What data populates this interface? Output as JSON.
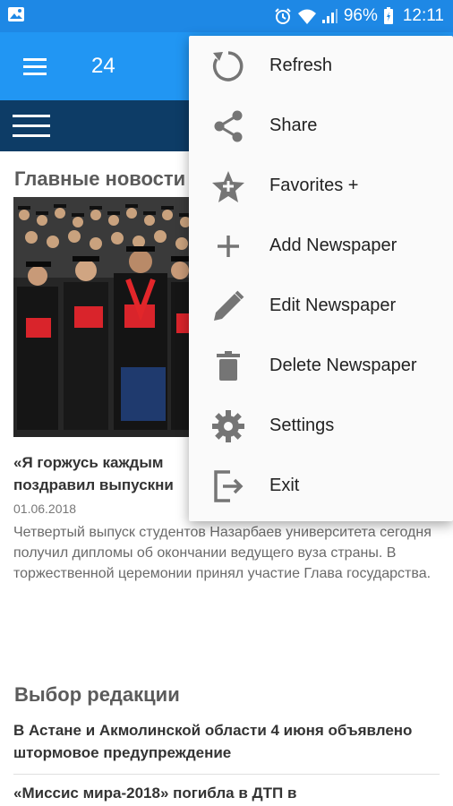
{
  "status_bar": {
    "battery_percent": "96%",
    "time": "12:11",
    "icons": [
      "image-icon",
      "alarm-icon",
      "wifi-icon",
      "signal-icon",
      "battery-icon"
    ]
  },
  "app_bar": {
    "title": "24",
    "background": "#2196f3"
  },
  "sub_bar": {
    "background": "#0d3c66"
  },
  "main": {
    "top_news_title": "Главные новости",
    "top_news": {
      "headline_line1": "«Я горжусь каждым",
      "headline_line2": "поздравил выпускни",
      "date": "01.06.2018",
      "summary": "Четвертый выпуск студентов Назарбаев университета сегодня получил дипломы об окончании ведущего вуза страны. В торжественной церемонии принял участие Глава государства."
    },
    "editors_choice_title": "Выбор редакции",
    "editors_choice": [
      {
        "title": "В Астане и Акмолинской области 4 июня объявлено штормовое предупреждение"
      },
      {
        "title": "«Миссис мира-2018» погибла в ДТП в"
      }
    ]
  },
  "overflow_menu": {
    "items": [
      {
        "label": "Refresh",
        "icon": "refresh-icon"
      },
      {
        "label": "Share",
        "icon": "share-icon"
      },
      {
        "label": "Favorites +",
        "icon": "star-icon"
      },
      {
        "label": "Add Newspaper",
        "icon": "plus-icon"
      },
      {
        "label": "Edit Newspaper",
        "icon": "pencil-icon"
      },
      {
        "label": "Delete Newspaper",
        "icon": "trash-icon"
      },
      {
        "label": "Settings",
        "icon": "gear-icon"
      },
      {
        "label": "Exit",
        "icon": "exit-icon"
      }
    ]
  },
  "colors": {
    "accent": "#2196f3",
    "status": "#1e88e5",
    "dark_bar": "#0d3c66",
    "icon_gray": "#757575"
  }
}
